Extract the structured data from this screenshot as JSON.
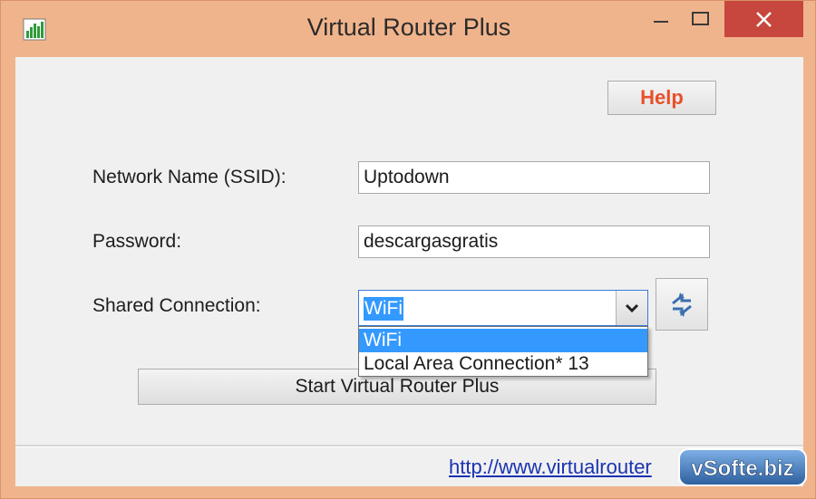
{
  "window": {
    "title": "Virtual Router Plus",
    "colors": {
      "frame": "#f0b48c",
      "close_button": "#c7463d",
      "accent": "#3399ff",
      "help_text": "#e8502a",
      "link": "#1a33b0"
    }
  },
  "header": {
    "help_label": "Help"
  },
  "form": {
    "ssid_label": "Network Name (SSID):",
    "ssid_value": "Uptodown",
    "password_label": "Password:",
    "password_value": "descargasgratis",
    "shared_label": "Shared Connection:",
    "shared_selected": "WiFi",
    "shared_options": [
      "WiFi",
      "Local Area Connection* 13"
    ]
  },
  "start_button_label": "Start Virtual Router Plus",
  "footer": {
    "link_text": "http://www.virtualrouter"
  },
  "watermark": "vSofte.biz",
  "icons": {
    "app": "signal-bars-icon",
    "minimize": "minimize-icon",
    "maximize": "maximize-icon",
    "close": "close-icon",
    "dropdown": "chevron-down-icon",
    "refresh": "refresh-icon"
  }
}
